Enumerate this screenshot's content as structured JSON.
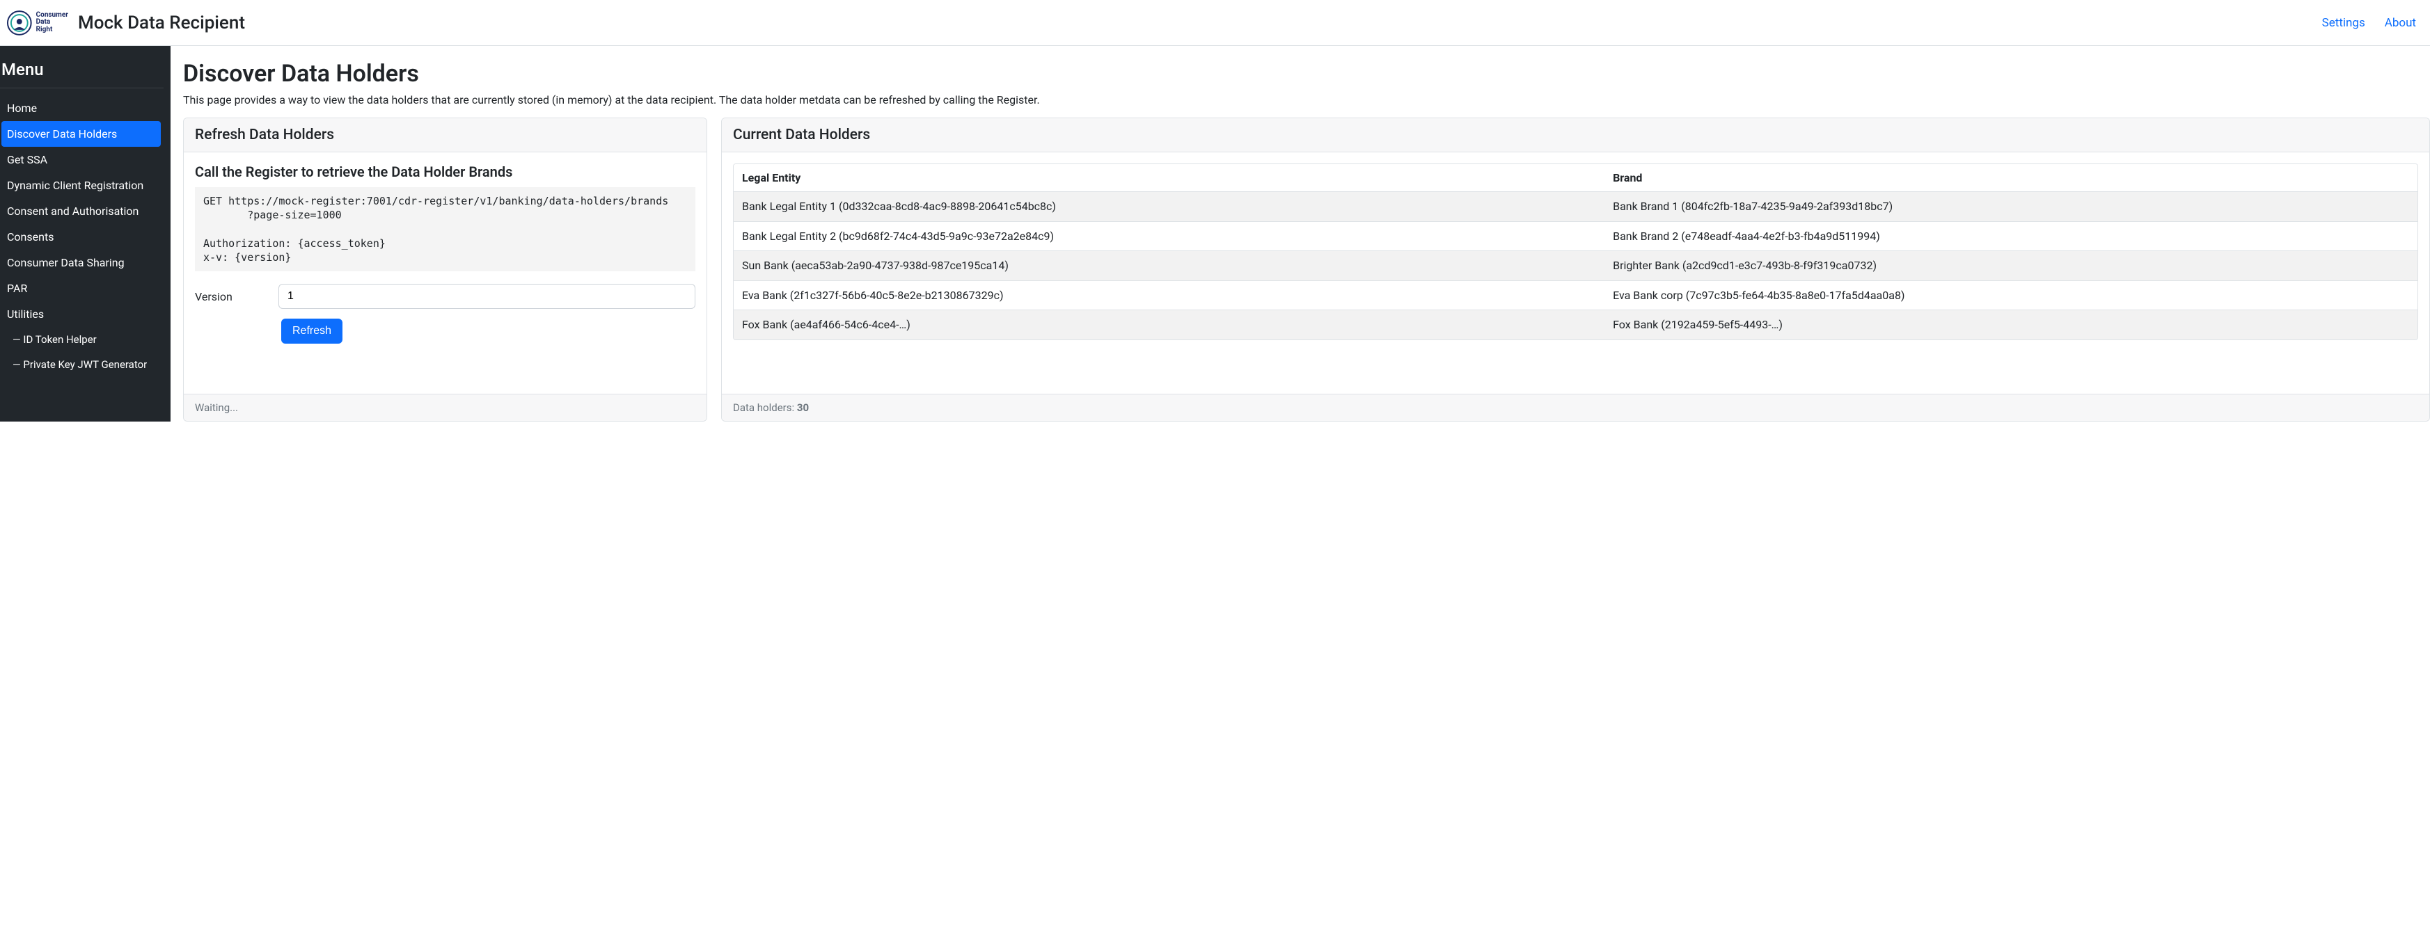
{
  "header": {
    "logo_text_top": "Consumer",
    "logo_text_bottom": "Data Right",
    "app_title": "Mock Data Recipient",
    "links": {
      "settings": "Settings",
      "about": "About"
    }
  },
  "sidebar": {
    "title": "Menu",
    "items": [
      {
        "label": "Home",
        "active": false
      },
      {
        "label": "Discover Data Holders",
        "active": true
      },
      {
        "label": "Get SSA",
        "active": false
      },
      {
        "label": "Dynamic Client Registration",
        "active": false
      },
      {
        "label": "Consent and Authorisation",
        "active": false
      },
      {
        "label": "Consents",
        "active": false
      },
      {
        "label": "Consumer Data Sharing",
        "active": false
      },
      {
        "label": "PAR",
        "active": false
      },
      {
        "label": "Utilities",
        "active": false
      }
    ],
    "sub_items": [
      {
        "label": "— ID Token Helper"
      },
      {
        "label": "— Private Key JWT Generator"
      }
    ]
  },
  "page": {
    "title": "Discover Data Holders",
    "description": "This page provides a way to view the data holders that are currently stored (in memory) at the data recipient. The data holder metdata can be refreshed by calling the Register."
  },
  "refresh_panel": {
    "header": "Refresh Data Holders",
    "section_title": "Call the Register to retrieve the Data Holder Brands",
    "code": "GET https://mock-register:7001/cdr-register/v1/banking/data-holders/brands\n       ?page-size=1000\n\nAuthorization: {access_token}\nx-v: {version}",
    "version_label": "Version",
    "version_value": "1",
    "refresh_button": "Refresh",
    "footer": "Waiting..."
  },
  "holders_panel": {
    "header": "Current Data Holders",
    "columns": {
      "legal_entity": "Legal Entity",
      "brand": "Brand"
    },
    "rows": [
      {
        "legal_entity": "Bank Legal Entity 1 (0d332caa-8cd8-4ac9-8898-20641c54bc8c)",
        "brand": "Bank Brand 1 (804fc2fb-18a7-4235-9a49-2af393d18bc7)"
      },
      {
        "legal_entity": "Bank Legal Entity 2 (bc9d68f2-74c4-43d5-9a9c-93e72a2e84c9)",
        "brand": "Bank Brand 2 (e748eadf-4aa4-4e2f-b3-fb4a9d511994)"
      },
      {
        "legal_entity": "Sun Bank (aeca53ab-2a90-4737-938d-987ce195ca14)",
        "brand": "Brighter Bank (a2cd9cd1-e3c7-493b-8-f9f319ca0732)"
      },
      {
        "legal_entity": "Eva Bank (2f1c327f-56b6-40c5-8e2e-b2130867329c)",
        "brand": "Eva Bank corp (7c97c3b5-fe64-4b35-8a8e0-17fa5d4aa0a8)"
      },
      {
        "legal_entity": "Fox Bank (ae4af466-54c6-4ce4-…)",
        "brand": "Fox Bank (2192a459-5ef5-4493-…)"
      }
    ],
    "footer_label": "Data holders: ",
    "footer_count": "30"
  }
}
